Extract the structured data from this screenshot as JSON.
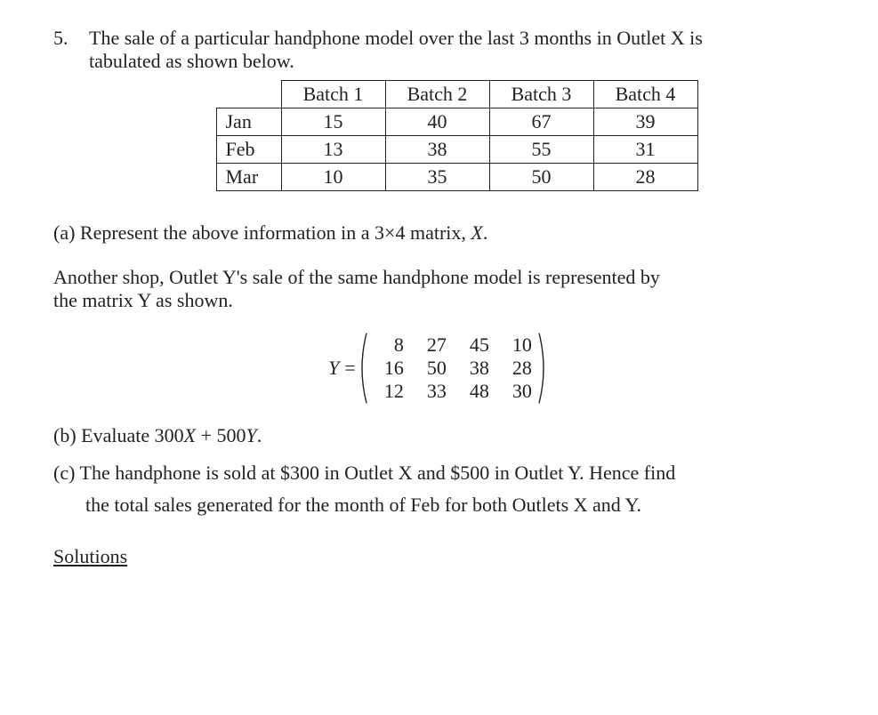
{
  "question": {
    "number": "5.",
    "intro_line1": "The sale of a particular handphone model over the last 3 months in Outlet X is",
    "intro_line2": "tabulated as shown below."
  },
  "table": {
    "headers": [
      "Batch 1",
      "Batch 2",
      "Batch 3",
      "Batch 4"
    ],
    "rows": [
      {
        "label": "Jan",
        "cells": [
          "15",
          "40",
          "67",
          "39"
        ]
      },
      {
        "label": "Feb",
        "cells": [
          "13",
          "38",
          "55",
          "31"
        ]
      },
      {
        "label": "Mar",
        "cells": [
          "10",
          "35",
          "50",
          "28"
        ]
      }
    ]
  },
  "part_a": {
    "prefix": "(a) Represent the above information in a  ",
    "dims": "3×4",
    "mid": "  matrix, ",
    "varX": "X",
    "suffix": "."
  },
  "between": {
    "line1": "Another shop, Outlet Y's sale of the same handphone model is represented by",
    "line2": "the matrix Y as shown."
  },
  "matrixY": {
    "labelY": "Y",
    "eq": " = ",
    "rows": [
      [
        "8",
        "27",
        "45",
        "10"
      ],
      [
        "16",
        "50",
        "38",
        "28"
      ],
      [
        "12",
        "33",
        "48",
        "30"
      ]
    ]
  },
  "part_b": {
    "prefix": "(b) Evaluate  ",
    "expr_300": "300",
    "expr_X": "X",
    "expr_plus": " + ",
    "expr_500": "500",
    "expr_Y": "Y",
    "suffix": "."
  },
  "part_c": {
    "line1": "(c) The handphone is sold at $300 in Outlet X and $500 in Outlet Y. Hence find",
    "line2": "the total sales generated for the month of Feb for both Outlets X and Y."
  },
  "solutions_heading": "Solutions",
  "chart_data": {
    "type": "table",
    "title": "Handphone sales by month and batch (Outlet X)",
    "categories": [
      "Batch 1",
      "Batch 2",
      "Batch 3",
      "Batch 4"
    ],
    "series": [
      {
        "name": "Jan",
        "values": [
          15,
          40,
          67,
          39
        ]
      },
      {
        "name": "Feb",
        "values": [
          13,
          38,
          55,
          31
        ]
      },
      {
        "name": "Mar",
        "values": [
          10,
          35,
          50,
          28
        ]
      }
    ],
    "matrix_Y": [
      [
        8,
        27,
        45,
        10
      ],
      [
        16,
        50,
        38,
        28
      ],
      [
        12,
        33,
        48,
        30
      ]
    ]
  }
}
